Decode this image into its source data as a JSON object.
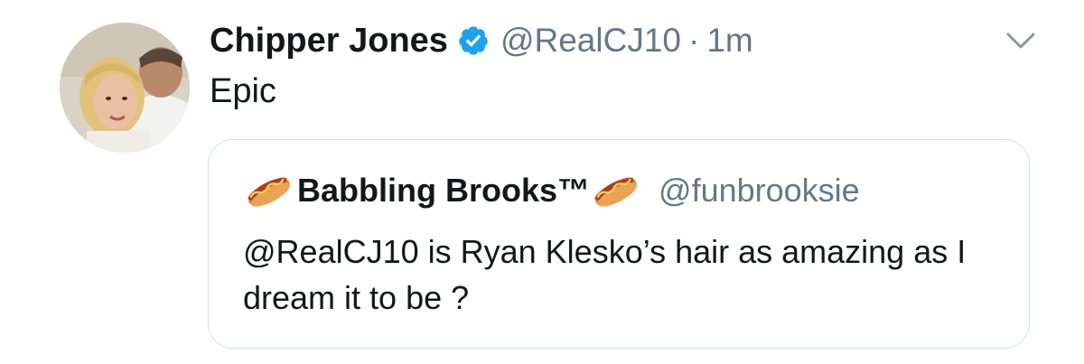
{
  "tweet": {
    "display_name": "Chipper Jones",
    "handle": "@RealCJ10",
    "separator": "·",
    "time": "1m",
    "text": "Epic",
    "verified": true,
    "more_menu_icon": "chevron-down-icon"
  },
  "quoted_tweet": {
    "display_name": "Babbling Brooks™",
    "name_emoji": "hotdog-icon",
    "handle": "@funbrooksie",
    "text": "@RealCJ10 is Ryan Klesko’s hair as amazing as I dream it to be ?"
  },
  "colors": {
    "verified_blue": "#1da1f2",
    "text": "#14171a",
    "secondary_text": "#657786",
    "border": "#d6dfe6"
  }
}
